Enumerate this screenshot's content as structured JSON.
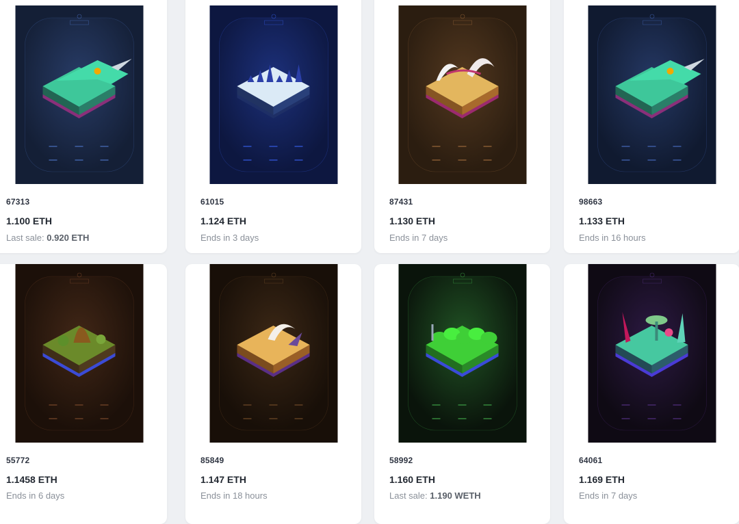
{
  "cards": [
    {
      "token_id": "67313",
      "price": "1.100 ETH",
      "status_prefix": "Last sale: ",
      "status_value": "0.920 ETH",
      "theme": "slate-dragon",
      "colors": {
        "bg": "#141f36",
        "panel": "#1c2a48",
        "top": "#3ec79a",
        "side": "#2a7e68",
        "base": "#8a2f7a"
      }
    },
    {
      "token_id": "61015",
      "price": "1.124 ETH",
      "status_prefix": "Ends in 3 days",
      "status_value": "",
      "theme": "ice",
      "colors": {
        "bg": "#0d1740",
        "panel": "#142256",
        "top": "#dbeaf6",
        "side": "#29407a",
        "base": "#1e2f66"
      }
    },
    {
      "token_id": "87431",
      "price": "1.130 ETH",
      "status_prefix": "Ends in 7 days",
      "status_value": "",
      "theme": "desert-bones",
      "colors": {
        "bg": "#2b1d10",
        "panel": "#3a2716",
        "top": "#e3b65e",
        "side": "#a86a2c",
        "base": "#9b2a6e"
      }
    },
    {
      "token_id": "98663",
      "price": "1.133 ETH",
      "status_prefix": "Ends in 16 hours",
      "status_value": "",
      "theme": "slate-dragon",
      "colors": {
        "bg": "#101a30",
        "panel": "#1a2746",
        "top": "#3ec79a",
        "side": "#2a7e68",
        "base": "#8a2f7a"
      }
    },
    {
      "token_id": "55772",
      "price": "1.1458 ETH",
      "status_prefix": "Ends in 6 days",
      "status_value": "",
      "theme": "jungle",
      "colors": {
        "bg": "#1c1009",
        "panel": "#2e1b10",
        "top": "#6b8a2a",
        "side": "#4f3a1e",
        "base": "#3b4bd6"
      }
    },
    {
      "token_id": "85849",
      "price": "1.147 ETH",
      "status_prefix": "Ends in 18 hours",
      "status_value": "",
      "theme": "desert",
      "colors": {
        "bg": "#180f08",
        "panel": "#2a1c0f",
        "top": "#e8b45a",
        "side": "#9a5f26",
        "base": "#5a2f86"
      }
    },
    {
      "token_id": "58992",
      "price": "1.160 ETH",
      "status_prefix": "Last sale: ",
      "status_value": "1.190 WETH",
      "theme": "slime",
      "colors": {
        "bg": "#0a140b",
        "panel": "#173b1a",
        "top": "#3fcf37",
        "side": "#2a8a28",
        "base": "#3a4bd8"
      }
    },
    {
      "token_id": "64061",
      "price": "1.169 ETH",
      "status_prefix": "Ends in 7 days",
      "status_value": "",
      "theme": "alien-flora",
      "colors": {
        "bg": "#0f0a14",
        "panel": "#1f1230",
        "top": "#46c8a0",
        "side": "#2c5d6a",
        "base": "#4a3bd6"
      }
    }
  ]
}
